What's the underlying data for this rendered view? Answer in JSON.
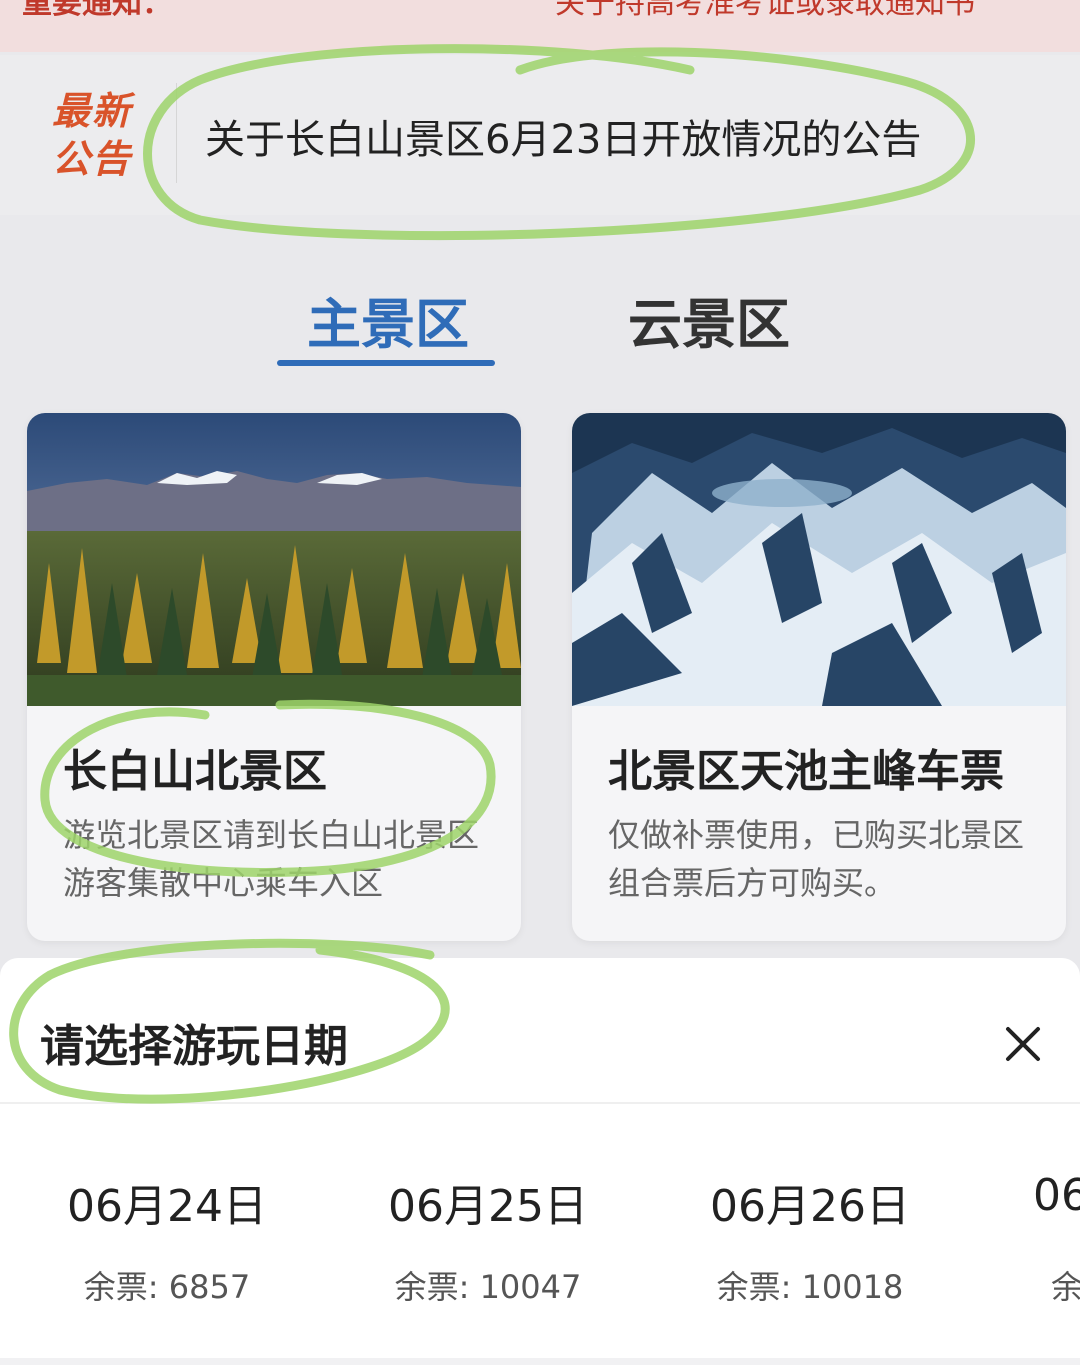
{
  "notice": {
    "label": "重要通知：",
    "text": "关于持高考准考证或录取通知书"
  },
  "announcement": {
    "tag": "最新公告",
    "text": "关于长白山景区6月23日开放情况的公告"
  },
  "tabs": [
    {
      "label": "主景区",
      "active": true
    },
    {
      "label": "云景区",
      "active": false
    }
  ],
  "cards": [
    {
      "title": "长白山北景区",
      "desc": "游览北景区请到长白山北景区游客集散中心乘车入区",
      "image": "forest-and-mountains"
    },
    {
      "title": "北景区天池主峰车票",
      "desc": "仅做补票使用，已购买北景区组合票后方可购买。",
      "image": "snowy-mountain-aerial"
    }
  ],
  "date_sheet": {
    "title": "请选择游玩日期",
    "close_icon": "close-icon",
    "dates": [
      {
        "date": "06月24日",
        "remain": "余票: 6857"
      },
      {
        "date": "06月25日",
        "remain": "余票: 10047"
      },
      {
        "date": "06月26日",
        "remain": "余票: 10018"
      },
      {
        "date": "06",
        "remain": "余"
      }
    ]
  },
  "colors": {
    "accent_blue": "#2f6cb8",
    "announce_red": "#d9532a",
    "highlight_green": "#9ed36a"
  }
}
